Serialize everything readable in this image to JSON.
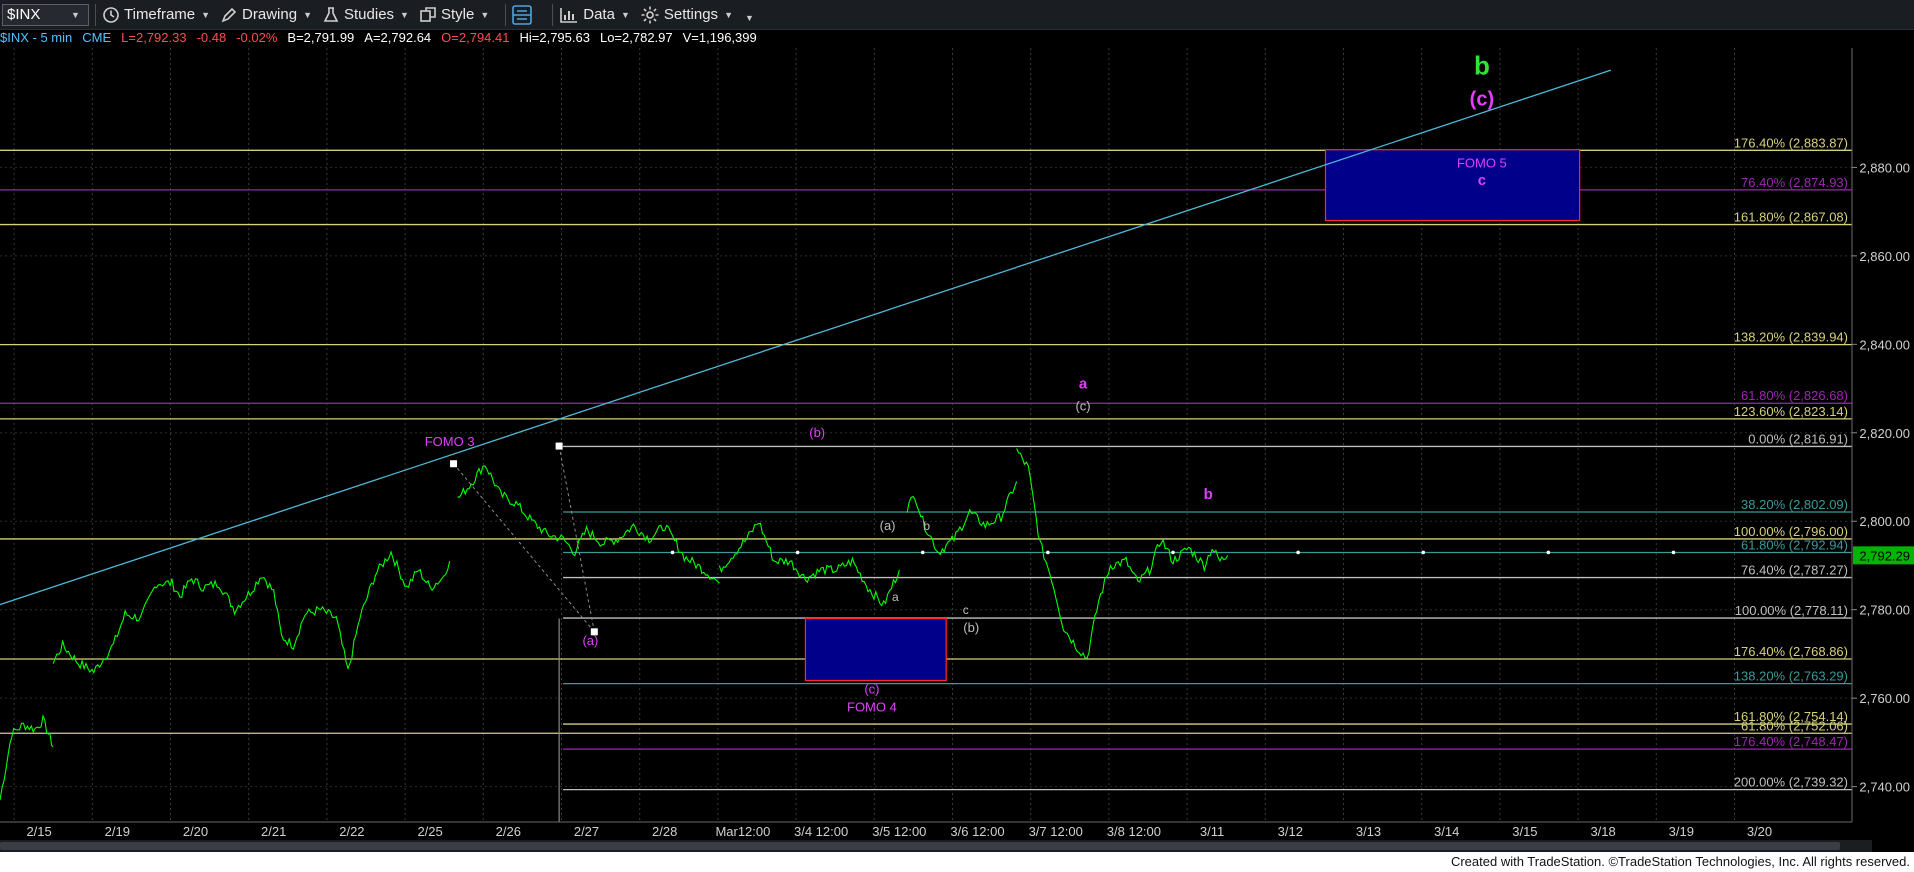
{
  "toolbar": {
    "symbol": "$INX",
    "items": [
      {
        "label": "Timeframe",
        "icon": "clock-icon"
      },
      {
        "label": "Drawing",
        "icon": "pencil-icon"
      },
      {
        "label": "Studies",
        "icon": "flask-icon"
      },
      {
        "label": "Style",
        "icon": "style-icon"
      },
      {
        "label": "Data",
        "icon": "bar-chart-icon"
      },
      {
        "label": "Settings",
        "icon": "gear-icon"
      }
    ]
  },
  "quote": [
    {
      "text": "$INX - 5 min",
      "color": "#4fc3ff"
    },
    {
      "text": "CME",
      "color": "#4fc3ff"
    },
    {
      "text": "L=2,792.33",
      "color": "#ff4d4d"
    },
    {
      "text": "-0.48",
      "color": "#ff4d4d"
    },
    {
      "text": "-0.02%",
      "color": "#ff4d4d"
    },
    {
      "text": "B=2,791.99",
      "color": "#ffffff"
    },
    {
      "text": "A=2,792.64",
      "color": "#ffffff"
    },
    {
      "text": "O=2,794.41",
      "color": "#ff4d4d"
    },
    {
      "text": "Hi=2,795.63",
      "color": "#ffffff"
    },
    {
      "text": "Lo=2,782.97",
      "color": "#ffffff"
    },
    {
      "text": "V=1,196,399",
      "color": "#ffffff"
    }
  ],
  "footer": {
    "text": "Created with TradeStation. ©TradeStation Technologies, Inc. All rights reserved."
  },
  "chart_data": {
    "type": "line",
    "title": "",
    "xlabel": "",
    "ylabel": "",
    "ylim": [
      2732,
      2907
    ],
    "y_ticks": [
      "2,740.00",
      "2,760.00",
      "2,780.00",
      "2,800.00",
      "2,820.00",
      "2,840.00",
      "2,860.00",
      "2,880.00"
    ],
    "y_tick_values": [
      2740,
      2760,
      2780,
      2800,
      2820,
      2840,
      2860,
      2880
    ],
    "x_ticks": [
      "2/15",
      "2/19",
      "2/20",
      "2/21",
      "2/22",
      "2/25",
      "2/26",
      "2/27",
      "2/28",
      "Mar12:00",
      "3/4 12:00",
      "3/5 12:00",
      "3/6 12:00",
      "3/7 12:00",
      "3/8 12:00",
      "3/11",
      "3/12",
      "3/13",
      "3/14",
      "3/15",
      "3/18",
      "3/19",
      "3/20"
    ],
    "x_tick_index": [
      0.5,
      1.5,
      2.5,
      3.5,
      4.5,
      5.5,
      6.5,
      7.5,
      8.5,
      9.5,
      10.5,
      11.5,
      12.5,
      13.5,
      14.5,
      15.5,
      16.5,
      17.5,
      18.5,
      19.5,
      20.5,
      21.5,
      22.5
    ],
    "last_price": "2,792.29",
    "last_price_value": 2792.29,
    "colors": {
      "price": "#00ff00",
      "trendline": "#4fb8d8",
      "fib_gold": "#d6d07a",
      "fib_purple": "#9c27b0",
      "fib_white": "#bfbfbf",
      "fib_teal": "#3a9a9a",
      "box": "#00008b",
      "box_border": "#ff2b2b",
      "magenta": "#e040fb",
      "green_label": "#34e03a",
      "axis_bg": "#000000"
    },
    "price_segments": [
      [
        [
          0.0,
          2737
        ],
        [
          0.08,
          2745
        ],
        [
          0.15,
          2752
        ],
        [
          0.3,
          2754
        ],
        [
          0.45,
          2753
        ],
        [
          0.55,
          2755
        ],
        [
          0.62,
          2752
        ],
        [
          0.68,
          2749
        ]
      ],
      [
        [
          0.68,
          2768
        ],
        [
          0.8,
          2772
        ],
        [
          1.0,
          2768
        ],
        [
          1.2,
          2766
        ],
        [
          1.45,
          2772
        ],
        [
          1.6,
          2779
        ],
        [
          1.8,
          2778
        ],
        [
          2.0,
          2786
        ],
        [
          2.2,
          2786
        ],
        [
          2.3,
          2783
        ],
        [
          2.45,
          2787
        ],
        [
          2.6,
          2785
        ],
        [
          2.8,
          2786
        ],
        [
          3.0,
          2780
        ],
        [
          3.2,
          2784
        ],
        [
          3.35,
          2788
        ],
        [
          3.5,
          2784
        ],
        [
          3.6,
          2774
        ],
        [
          3.75,
          2772
        ],
        [
          3.9,
          2779
        ],
        [
          4.1,
          2780
        ],
        [
          4.3,
          2778
        ],
        [
          4.45,
          2766
        ],
        [
          4.6,
          2778
        ],
        [
          4.8,
          2788
        ],
        [
          5.0,
          2793
        ],
        [
          5.2,
          2785
        ],
        [
          5.35,
          2789
        ],
        [
          5.5,
          2785
        ],
        [
          5.65,
          2787
        ],
        [
          5.75,
          2791
        ]
      ],
      [
        [
          5.85,
          2805
        ],
        [
          6.0,
          2808
        ],
        [
          6.2,
          2813
        ],
        [
          6.4,
          2806
        ],
        [
          6.6,
          2804
        ],
        [
          6.8,
          2800
        ],
        [
          7.0,
          2797
        ],
        [
          7.2,
          2796
        ],
        [
          7.35,
          2793
        ],
        [
          7.5,
          2798
        ],
        [
          7.7,
          2795
        ],
        [
          7.9,
          2796
        ],
        [
          8.1,
          2799
        ],
        [
          8.3,
          2796
        ],
        [
          8.5,
          2799
        ],
        [
          8.75,
          2792
        ],
        [
          9.0,
          2789
        ],
        [
          9.2,
          2786
        ]
      ],
      [
        [
          9.2,
          2789
        ],
        [
          9.4,
          2793
        ],
        [
          9.55,
          2796
        ],
        [
          9.7,
          2800
        ],
        [
          9.9,
          2791
        ],
        [
          10.1,
          2791
        ],
        [
          10.3,
          2787
        ],
        [
          10.5,
          2789
        ],
        [
          10.7,
          2789
        ],
        [
          10.9,
          2791
        ],
        [
          11.1,
          2785
        ],
        [
          11.3,
          2781
        ],
        [
          11.5,
          2789
        ]
      ],
      [
        [
          11.6,
          2803
        ],
        [
          11.7,
          2806
        ],
        [
          11.8,
          2800
        ],
        [
          12.0,
          2793
        ],
        [
          12.2,
          2796
        ],
        [
          12.4,
          2802
        ],
        [
          12.6,
          2799
        ],
        [
          12.8,
          2801
        ],
        [
          13.0,
          2809
        ]
      ],
      [
        [
          13.0,
          2816
        ],
        [
          13.15,
          2812
        ],
        [
          13.3,
          2795
        ],
        [
          13.45,
          2787
        ],
        [
          13.6,
          2776
        ],
        [
          13.75,
          2772
        ],
        [
          13.9,
          2769
        ],
        [
          14.05,
          2782
        ],
        [
          14.2,
          2790
        ],
        [
          14.4,
          2791
        ],
        [
          14.55,
          2786
        ],
        [
          14.7,
          2789
        ],
        [
          14.85,
          2796
        ],
        [
          15.0,
          2791
        ],
        [
          15.2,
          2794
        ],
        [
          15.4,
          2790
        ],
        [
          15.5,
          2794
        ],
        [
          15.6,
          2791
        ],
        [
          15.7,
          2792.3
        ]
      ]
    ],
    "fib_levels": [
      {
        "label": "176.40% (2,883.87)",
        "value": 2883.87,
        "color": "#d6d07a",
        "x_start": 0
      },
      {
        "label": "76.40% (2,874.93)",
        "value": 2874.93,
        "color": "#9c27b0",
        "x_start": 0
      },
      {
        "label": "161.80% (2,867.08)",
        "value": 2867.08,
        "color": "#d6d07a",
        "x_start": 0
      },
      {
        "label": "138.20% (2,839.94)",
        "value": 2839.94,
        "color": "#d6d07a",
        "x_start": 0
      },
      {
        "label": "61.80% (2,826.68)",
        "value": 2826.68,
        "color": "#9c27b0",
        "x_start": 0
      },
      {
        "label": "123.60% (2,823.14)",
        "value": 2823.14,
        "color": "#d6d07a",
        "x_start": 0
      },
      {
        "label": "0.00% (2,816.91)",
        "value": 2816.91,
        "color": "#bfbfbf",
        "x_start": 7.2
      },
      {
        "label": "38.20% (2,802.09)",
        "value": 2802.09,
        "color": "#3a9a9a",
        "x_start": 7.2
      },
      {
        "label": "100.00% (2,796.00)",
        "value": 2796.0,
        "color": "#d6d07a",
        "x_start": 0
      },
      {
        "label": "61.80% (2,792.94)",
        "value": 2792.94,
        "color": "#3a9a9a",
        "x_start": 7.2
      },
      {
        "label": "76.40% (2,787.27)",
        "value": 2787.27,
        "color": "#bfbfbf",
        "x_start": 7.2
      },
      {
        "label": "100.00% (2,778.11)",
        "value": 2778.11,
        "color": "#bfbfbf",
        "x_start": 7.2
      },
      {
        "label": "176.40% (2,768.86)",
        "value": 2768.86,
        "color": "#d6d07a",
        "x_start": 0
      },
      {
        "label": "138.20% (2,763.29)",
        "value": 2763.29,
        "color": "#3a9a9a",
        "x_start": 7.2
      },
      {
        "label": "161.80% (2,754.14)",
        "value": 2754.14,
        "color": "#d6d07a",
        "x_start": 7.2
      },
      {
        "label": "61.80% (2,752.06)",
        "value": 2752.06,
        "color": "#d6d07a",
        "x_start": 0
      },
      {
        "label": "176.40% (2,748.47)",
        "value": 2748.47,
        "color": "#9c27b0",
        "x_start": 7.2
      },
      {
        "label": "200.00% (2,739.32)",
        "value": 2739.32,
        "color": "#bfbfbf",
        "x_start": 7.2
      }
    ],
    "boxes": [
      {
        "x0": 16.95,
        "x1": 20.2,
        "y0": 2868,
        "y1": 2884
      },
      {
        "x0": 10.3,
        "x1": 12.1,
        "y0": 2764,
        "y1": 2778
      }
    ],
    "trendline": {
      "x0": -0.2,
      "y0": 2780,
      "x1": 20.6,
      "y1": 2902
    },
    "dotted_line": {
      "value": 2792.94,
      "x0": 8.6,
      "x1": 21.8
    },
    "fib_anchor_lines": [
      {
        "x0": 5.8,
        "y0": 2813,
        "x1": 7.6,
        "y1": 2775
      },
      {
        "x0": 7.15,
        "y0": 2817,
        "x1": 7.6,
        "y1": 2775
      }
    ],
    "anchor_points": [
      {
        "x": 5.8,
        "y": 2813
      },
      {
        "x": 7.15,
        "y": 2817
      },
      {
        "x": 7.6,
        "y": 2775
      }
    ],
    "vertical_line": {
      "x": 7.15,
      "y0": 2732,
      "y1": 2778
    },
    "annotations": [
      {
        "text": "b",
        "x": 18.95,
        "y": 2901,
        "color": "#34e03a",
        "size": 26,
        "bold": true
      },
      {
        "text": "(c)",
        "x": 18.95,
        "y": 2894,
        "color": "#e040fb",
        "size": 20,
        "bold": true
      },
      {
        "text": "FOMO 5",
        "x": 18.95,
        "y": 2880,
        "color": "#e040fb",
        "size": 13,
        "bold": false
      },
      {
        "text": "c",
        "x": 18.95,
        "y": 2876,
        "color": "#e040fb",
        "size": 15,
        "bold": true
      },
      {
        "text": "a",
        "x": 13.85,
        "y": 2830,
        "color": "#e040fb",
        "size": 15,
        "bold": true
      },
      {
        "text": "(c)",
        "x": 13.85,
        "y": 2825,
        "color": "#bfbfbf",
        "size": 13,
        "bold": false
      },
      {
        "text": "FOMO 3",
        "x": 5.75,
        "y": 2817,
        "color": "#e040fb",
        "size": 13,
        "bold": false
      },
      {
        "text": "(b)",
        "x": 10.45,
        "y": 2819,
        "color": "#e040fb",
        "size": 13,
        "bold": false
      },
      {
        "text": "b",
        "x": 15.45,
        "y": 2805,
        "color": "#e040fb",
        "size": 15,
        "bold": true
      },
      {
        "text": "(a)",
        "x": 11.35,
        "y": 2798,
        "color": "#bfbfbf",
        "size": 13,
        "bold": false
      },
      {
        "text": "b",
        "x": 11.85,
        "y": 2798,
        "color": "#bfbfbf",
        "size": 12,
        "bold": false
      },
      {
        "text": "a",
        "x": 11.45,
        "y": 2782,
        "color": "#bfbfbf",
        "size": 12,
        "bold": false
      },
      {
        "text": "c",
        "x": 12.35,
        "y": 2779,
        "color": "#bfbfbf",
        "size": 12,
        "bold": false
      },
      {
        "text": "(b)",
        "x": 12.42,
        "y": 2775,
        "color": "#bfbfbf",
        "size": 13,
        "bold": false
      },
      {
        "text": "(a)",
        "x": 7.55,
        "y": 2772,
        "color": "#e040fb",
        "size": 13,
        "bold": false
      },
      {
        "text": "(c)",
        "x": 11.15,
        "y": 2761,
        "color": "#e040fb",
        "size": 13,
        "bold": false
      },
      {
        "text": "FOMO 4",
        "x": 11.15,
        "y": 2757,
        "color": "#e040fb",
        "size": 13,
        "bold": false
      }
    ]
  }
}
